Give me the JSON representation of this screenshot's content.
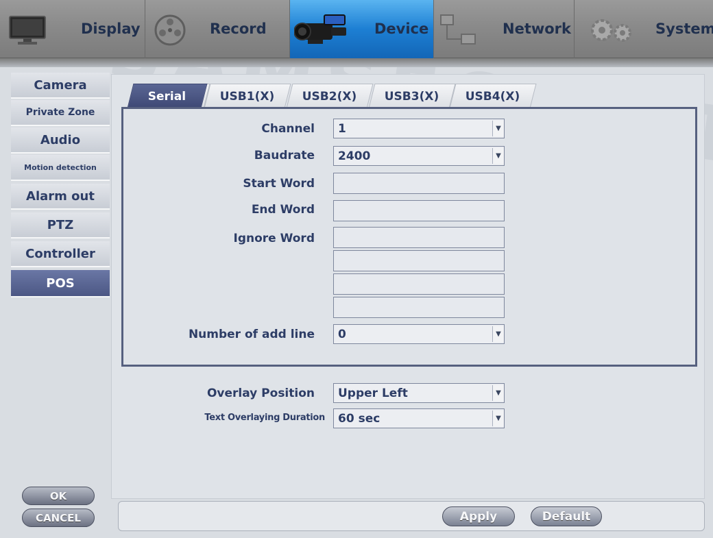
{
  "top_menu": {
    "items": [
      {
        "label": "Display",
        "icon": "monitor-icon"
      },
      {
        "label": "Record",
        "icon": "film-reel-icon"
      },
      {
        "label": "Device",
        "icon": "camcorder-icon"
      },
      {
        "label": "Network",
        "icon": "network-icon"
      },
      {
        "label": "System",
        "icon": "gears-icon"
      }
    ],
    "active": "Device",
    "active_color": "#1d7fd3"
  },
  "sidebar": {
    "items": [
      {
        "label": "Camera"
      },
      {
        "label": "Private Zone"
      },
      {
        "label": "Audio"
      },
      {
        "label": "Motion detection"
      },
      {
        "label": "Alarm out"
      },
      {
        "label": "PTZ"
      },
      {
        "label": "Controller"
      },
      {
        "label": "POS"
      }
    ],
    "active": "POS",
    "ok_label": "OK",
    "cancel_label": "CANCEL"
  },
  "tabs": {
    "items": [
      {
        "label": "Serial"
      },
      {
        "label": "USB1(X)"
      },
      {
        "label": "USB2(X)"
      },
      {
        "label": "USB3(X)"
      },
      {
        "label": "USB4(X)"
      }
    ],
    "active": "Serial"
  },
  "form": {
    "channel": {
      "label": "Channel",
      "value": "1"
    },
    "baudrate": {
      "label": "Baudrate",
      "value": "2400"
    },
    "start_word": {
      "label": "Start Word",
      "value": ""
    },
    "end_word": {
      "label": "End Word",
      "value": ""
    },
    "ignore_word": {
      "label": "Ignore Word",
      "values": [
        "",
        "",
        "",
        ""
      ]
    },
    "add_line": {
      "label": "Number of add line",
      "value": "0"
    },
    "overlay_position": {
      "label": "Overlay Position",
      "value": "Upper Left"
    },
    "overlay_duration": {
      "label": "Text Overlaying Duration",
      "value": "60 sec"
    }
  },
  "buttons": {
    "apply": "Apply",
    "default": "Default"
  },
  "watermark": "SAMSECURITY"
}
